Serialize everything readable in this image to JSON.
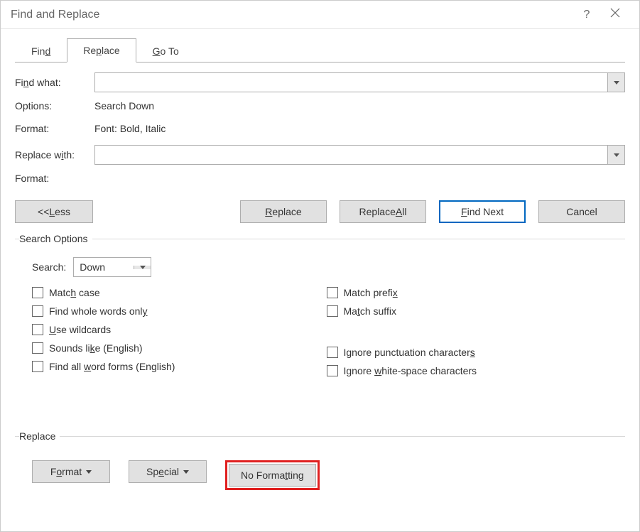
{
  "window": {
    "title": "Find and Replace"
  },
  "tabs": {
    "find": "Find",
    "replace": "Replace",
    "goto": "Go To",
    "find_ul": "d",
    "replace_ul": "P",
    "goto_ul": "G"
  },
  "labels": {
    "find_what": "Find what:",
    "options": "Options:",
    "format": "Format:",
    "replace_with": "Replace with:",
    "format2": "Format:",
    "search_options_legend": "Search Options",
    "search": "Search:",
    "replace_legend": "Replace"
  },
  "values": {
    "find_what": "",
    "options": "Search Down",
    "find_format": "Font: Bold, Italic",
    "replace_with": "",
    "replace_format": "",
    "search_direction": "Down"
  },
  "buttons": {
    "less": "<<  Less",
    "replace": "Replace",
    "replace_all": "Replace All",
    "find_next": "Find Next",
    "cancel": "Cancel",
    "format": "Format",
    "special": "Special",
    "no_formatting": "No Formatting"
  },
  "checkboxes": {
    "left": [
      {
        "label": "Match case",
        "ul": "H",
        "text_before": "Matc",
        "text_after": " case"
      },
      {
        "label": "Find whole words only",
        "ul": "y",
        "text_before": "Find whole words onl",
        "text_after": ""
      },
      {
        "label": "Use wildcards",
        "ul": "U",
        "text_before": "",
        "text_after": "se wildcards"
      },
      {
        "label": "Sounds like (English)",
        "ul": "",
        "text_before": "Sounds li",
        "text_after": "e (English)",
        "ul_char": "k"
      },
      {
        "label": "Find all word forms (English)",
        "ul": "w",
        "text_before": "Find all ",
        "text_after": "ord forms (English)"
      }
    ],
    "right": [
      {
        "label": "Match prefix",
        "ul": "",
        "text_before": "Match prefi",
        "text_after": "",
        "ul_char": "x"
      },
      {
        "label": "Match suffix",
        "ul": "t",
        "text_before": "Ma",
        "text_after": "ch suffix"
      },
      {
        "label": "Ignore punctuation characters",
        "ul": "s",
        "text_before": "Ignore punctuation character",
        "text_after": ""
      },
      {
        "label": "Ignore white-space characters",
        "ul": "w",
        "text_before": "Ignore ",
        "text_after": "hite-space characters"
      }
    ]
  }
}
